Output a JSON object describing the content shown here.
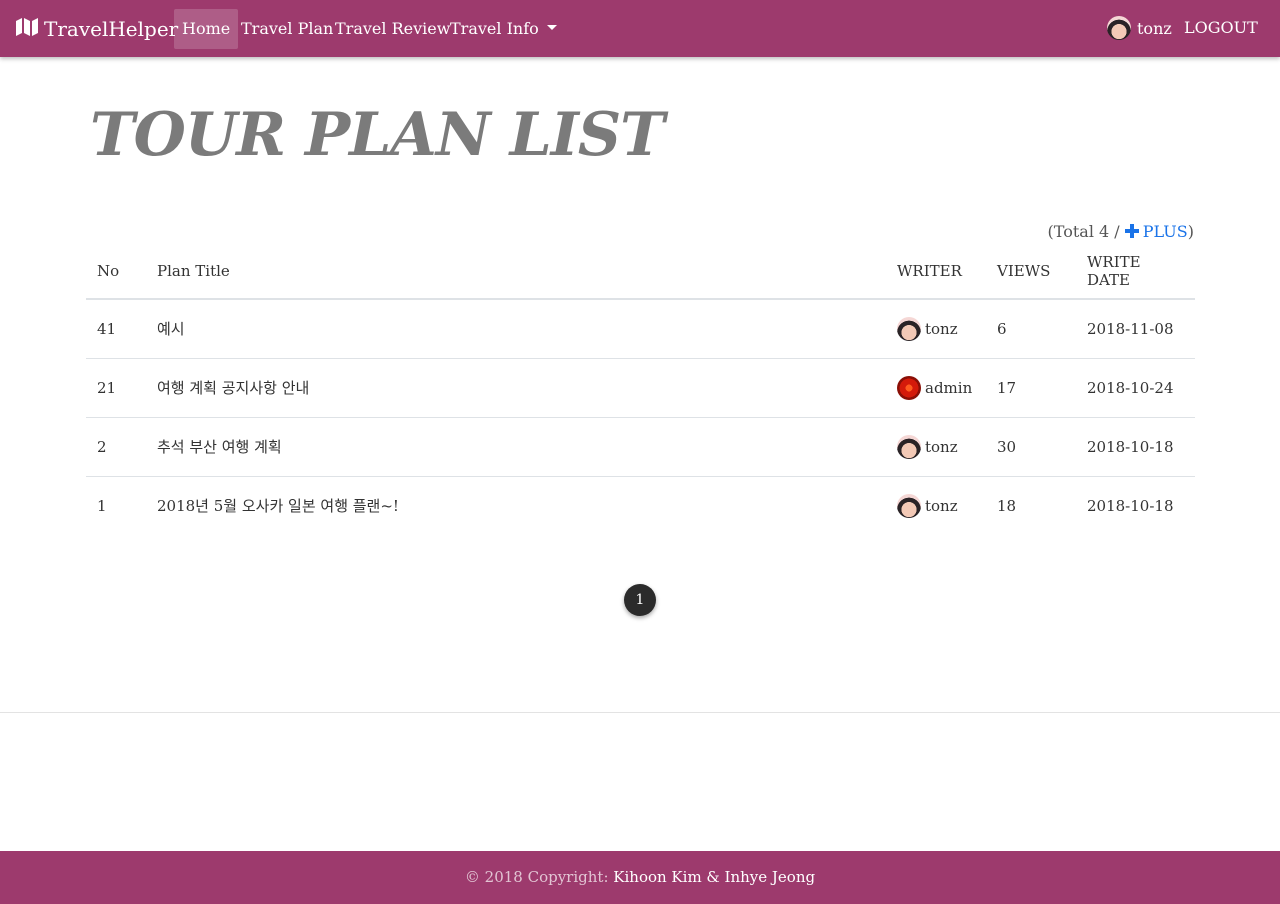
{
  "navbar": {
    "brand": "TravelHelper",
    "brand_icon": "map-icon",
    "items": [
      {
        "label": "Home",
        "active": true
      },
      {
        "label": "Travel Plan"
      },
      {
        "label": "Travel Review"
      },
      {
        "label": "Travel Info"
      }
    ],
    "user": "tonz",
    "logout": "LOGOUT",
    "bg_color": "#9d3a6d"
  },
  "page_title": "TOUR PLAN LIST",
  "total": {
    "prefix": "(Total 4 /",
    "plus_label": "PLUS",
    "suffix": ")",
    "plus_color": "#1a73e8"
  },
  "table": {
    "headers": {
      "no": "No",
      "title": "Plan Title",
      "writer": "WRITER",
      "views": "VIEWS",
      "date": "WRITE DATE"
    },
    "rows": [
      {
        "no": "41",
        "title": "예시",
        "writer": "tonz",
        "views": "6",
        "date": "2018-11-08"
      },
      {
        "no": "21",
        "title": "여행 계획 공지사항 안내",
        "writer": "admin",
        "views": "17",
        "date": "2018-10-24"
      },
      {
        "no": "2",
        "title": "추석 부산 여행 계획",
        "writer": "tonz",
        "views": "30",
        "date": "2018-10-18"
      },
      {
        "no": "1",
        "title": "2018년 5월 오사카 일본 여행 플랜~!",
        "writer": "tonz",
        "views": "18",
        "date": "2018-10-18"
      }
    ]
  },
  "pagination": {
    "current": "1"
  },
  "footer": {
    "copyright": "© 2018 Copyright:",
    "authors": "Kihoon Kim & Inhye Jeong"
  }
}
